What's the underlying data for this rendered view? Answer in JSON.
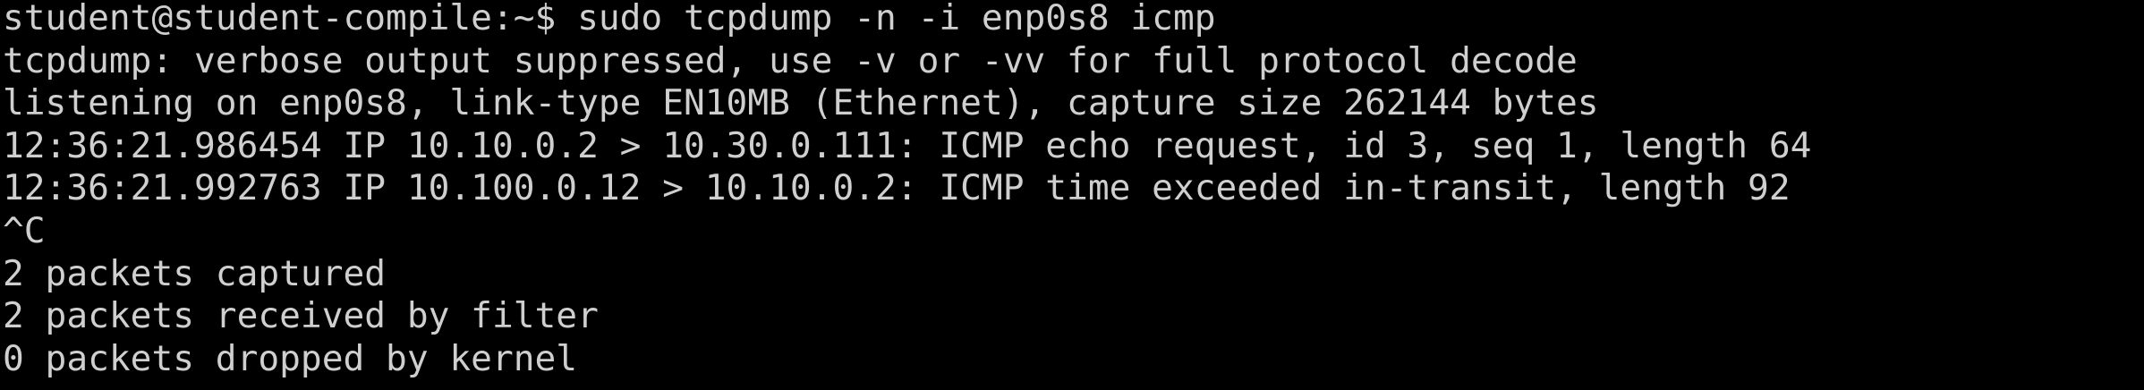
{
  "terminal": {
    "colors": {
      "background": "#000000",
      "foreground": "#cfcfcf"
    },
    "lines": [
      "student@student-compile:~$ sudo tcpdump -n -i enp0s8 icmp",
      "tcpdump: verbose output suppressed, use -v or -vv for full protocol decode",
      "listening on enp0s8, link-type EN10MB (Ethernet), capture size 262144 bytes",
      "12:36:21.986454 IP 10.10.0.2 > 10.30.0.111: ICMP echo request, id 3, seq 1, length 64",
      "12:36:21.992763 IP 10.100.0.12 > 10.10.0.2: ICMP time exceeded in-transit, length 92",
      "^C",
      "2 packets captured",
      "2 packets received by filter",
      "0 packets dropped by kernel"
    ]
  }
}
